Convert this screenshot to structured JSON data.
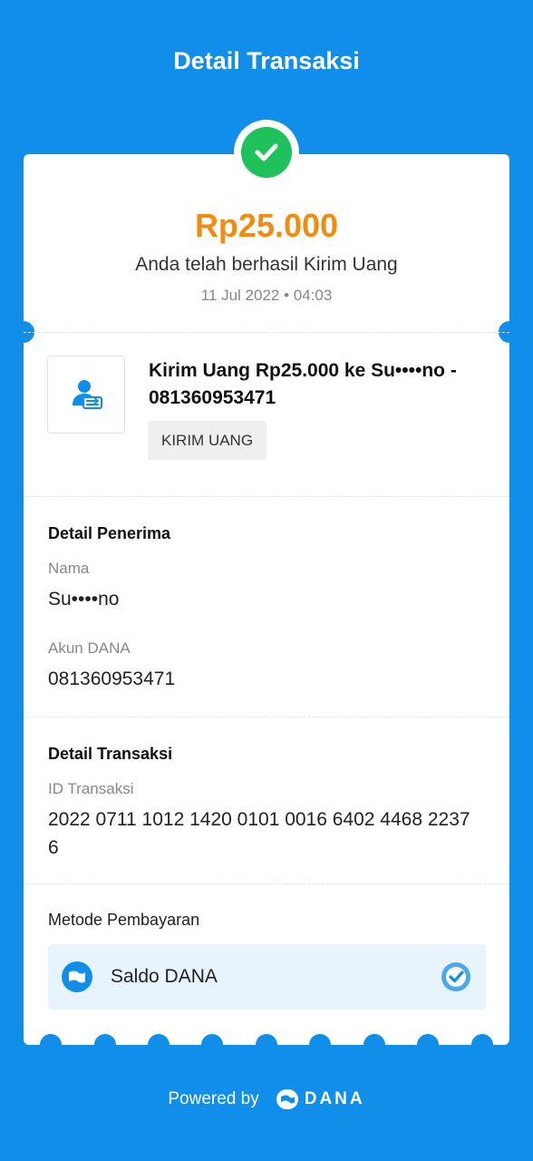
{
  "header": {
    "title": "Detail Transaksi"
  },
  "summary": {
    "amount": "Rp25.000",
    "message": "Anda telah berhasil Kirim Uang",
    "datetime": "11 Jul 2022 • 04:03",
    "status_icon": "check-circle-icon"
  },
  "transaction": {
    "icon": "send-money-icon",
    "title": "Kirim Uang Rp25.000 ke Su••••no - 081360953471",
    "tag": "KIRIM UANG"
  },
  "recipient": {
    "section_title": "Detail Penerima",
    "name_label": "Nama",
    "name_value": "Su••••no",
    "account_label": "Akun DANA",
    "account_value": "081360953471"
  },
  "details": {
    "section_title": "Detail Transaksi",
    "id_label": "ID Transaksi",
    "id_value": "2022 0711 1012 1420 0101 0016 6402 4468 2237 6"
  },
  "payment": {
    "label": "Metode Pembayaran",
    "method": "Saldo DANA",
    "method_icon": "wallet-icon",
    "selected_icon": "check-badge-icon"
  },
  "footer": {
    "powered_by": "Powered by",
    "brand": "DANA"
  },
  "colors": {
    "background": "#108ee9",
    "amount": "#f28c11",
    "success": "#1fc15a",
    "payment_box": "#e7f4fd"
  }
}
